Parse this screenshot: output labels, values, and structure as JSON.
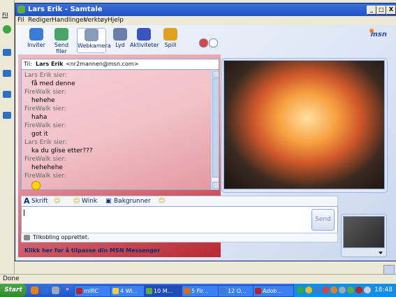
{
  "background": {
    "left_menu_letter": "Fil",
    "statusbar_text": "Done"
  },
  "window": {
    "title": "Lars Erik - Samtale",
    "controls": {
      "minimize": "_",
      "maximize": "□",
      "close": "X"
    },
    "menu": [
      "Fil",
      "Rediger",
      "Handlinger",
      "Verktøy",
      "Hjelp"
    ]
  },
  "toolbar": {
    "buttons": [
      {
        "label": "Inviter",
        "icon": "invite-icon",
        "color": "#3a7bd5"
      },
      {
        "label": "Send filer",
        "icon": "send-files-icon",
        "color": "#4aa56a"
      },
      {
        "label": "Webkamera",
        "icon": "webcam-icon",
        "color": "#8a9bb8"
      },
      {
        "label": "Lyd",
        "icon": "audio-icon",
        "color": "#6a7fa8"
      },
      {
        "label": "Aktiviteter",
        "icon": "activities-icon",
        "color": "#3a55c0"
      },
      {
        "label": "Spill",
        "icon": "games-icon",
        "color": "#e0a020"
      }
    ],
    "brand": "msn"
  },
  "chat": {
    "to_label": "Til:",
    "to_name": "Lars Erik",
    "to_email": "<nr2mannen@msn.com>",
    "lines": [
      {
        "kind": "sender",
        "text": "Lars Erik sier:"
      },
      {
        "kind": "msg",
        "text": "få med denne"
      },
      {
        "kind": "sender",
        "text": "FireWalk sier:"
      },
      {
        "kind": "msg",
        "text": "hehehe"
      },
      {
        "kind": "sender",
        "text": "FireWalk sier:"
      },
      {
        "kind": "msg",
        "text": "haha"
      },
      {
        "kind": "sender",
        "text": "FireWalk sier:"
      },
      {
        "kind": "msg",
        "text": "got it"
      },
      {
        "kind": "sender",
        "text": "Lars Erik sier:"
      },
      {
        "kind": "msg",
        "text": "ka du glise etter???"
      },
      {
        "kind": "sender",
        "text": "FireWalk sier:"
      },
      {
        "kind": "msg",
        "text": "hehehehe"
      },
      {
        "kind": "sender",
        "text": "FireWalk sier:"
      }
    ]
  },
  "input": {
    "font_label": "Skrift",
    "wink_label": "Wink",
    "backgrounds_label": "Bakgrunner",
    "send_label": "Send",
    "value": ""
  },
  "status": {
    "text": "Tilkobling opprettet."
  },
  "customize_link": "Klikk her for å tilpasse din MSN Messenger",
  "taskbar": {
    "start": "Start",
    "tasks": [
      "mIRC",
      "4 Wi...",
      "10 M...",
      "5 Fir...",
      "12 O...",
      "Adob..."
    ],
    "clock": "18:48"
  },
  "colors": {
    "accent": "#2d4fa0",
    "title_bar": "#2152c4",
    "taskbar": "#2455c8"
  }
}
